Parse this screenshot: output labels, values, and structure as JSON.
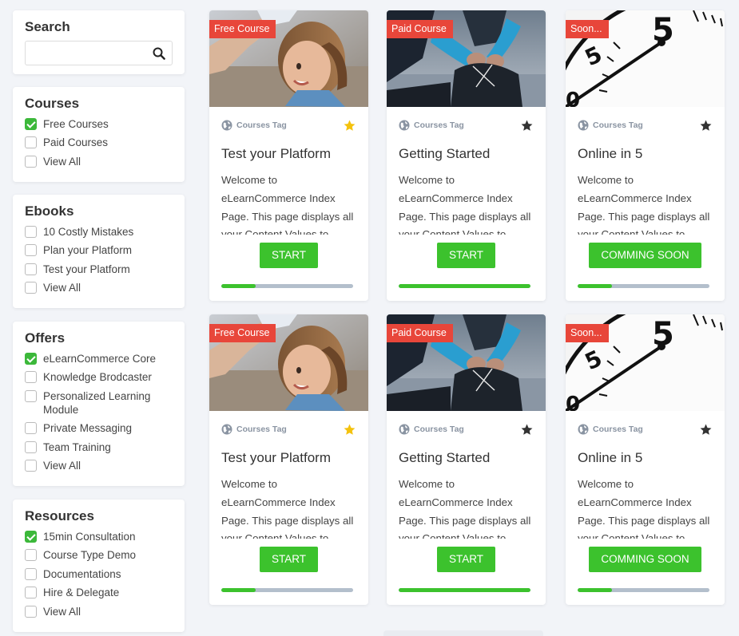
{
  "colors": {
    "accent_green": "#3cc22d",
    "ribbon_red": "#e8463a",
    "star_gold": "#f4c20d",
    "star_dark": "#333333",
    "progress_track": "#b3bfcc"
  },
  "search": {
    "title": "Search",
    "placeholder": "",
    "icon": "search-icon"
  },
  "courses": {
    "title": "Courses",
    "items": [
      {
        "label": "Free Courses",
        "checked": true
      },
      {
        "label": "Paid Courses",
        "checked": false
      },
      {
        "label": "View All",
        "checked": false
      }
    ]
  },
  "ebooks": {
    "title": "Ebooks",
    "items": [
      {
        "label": "10 Costly Mistakes",
        "checked": false
      },
      {
        "label": "Plan your Platform",
        "checked": false
      },
      {
        "label": "Test your Platform",
        "checked": false
      },
      {
        "label": "View All",
        "checked": false
      }
    ]
  },
  "offers": {
    "title": "Offers",
    "items": [
      {
        "label": "eLearnCommerce Core",
        "checked": true
      },
      {
        "label": "Knowledge Brodcaster",
        "checked": false
      },
      {
        "label": "Personalized Learning Module",
        "checked": false
      },
      {
        "label": "Private Messaging",
        "checked": false
      },
      {
        "label": "Team Training",
        "checked": false
      },
      {
        "label": "View All",
        "checked": false
      }
    ]
  },
  "resources": {
    "title": "Resources",
    "items": [
      {
        "label": "15min Consultation",
        "checked": true
      },
      {
        "label": "Course Type Demo",
        "checked": false
      },
      {
        "label": "Documentations",
        "checked": false
      },
      {
        "label": "Hire & Delegate",
        "checked": false
      },
      {
        "label": "View All",
        "checked": false
      }
    ]
  },
  "cards": [
    {
      "ribbon": "Free Course",
      "image": "girl-photo",
      "tag": "Courses Tag",
      "starred": true,
      "title": "Test your Platform",
      "desc": "Welcome to eLearnCommerce Index Page. This page displays all your Content Values to",
      "button": "START",
      "progress": 0.26
    },
    {
      "ribbon": "Paid Course",
      "image": "shoelace-photo",
      "tag": "Courses Tag",
      "starred": false,
      "title": "Getting Started",
      "desc": "Welcome to eLearnCommerce Index Page. This page displays all your Content Values to",
      "button": "START",
      "progress": 1.0
    },
    {
      "ribbon": "Soon...",
      "image": "stopwatch-photo",
      "tag": "Courses Tag",
      "starred": false,
      "title": "Online in 5",
      "desc": "Welcome to eLearnCommerce Index Page. This page displays all your Content Values to",
      "button": "COMMING SOON",
      "progress": 0.26
    },
    {
      "ribbon": "Free Course",
      "image": "girl-photo",
      "tag": "Courses Tag",
      "starred": true,
      "title": "Test your Platform",
      "desc": "Welcome to eLearnCommerce Index Page. This page displays all your Content Values to",
      "button": "START",
      "progress": 0.26
    },
    {
      "ribbon": "Paid Course",
      "image": "shoelace-photo",
      "tag": "Courses Tag",
      "starred": false,
      "title": "Getting Started",
      "desc": "Welcome to eLearnCommerce Index Page. This page displays all your Content Values to",
      "button": "START",
      "progress": 1.0
    },
    {
      "ribbon": "Soon...",
      "image": "stopwatch-photo",
      "tag": "Courses Tag",
      "starred": false,
      "title": "Online in 5",
      "desc": "Welcome to eLearnCommerce Index Page. This page displays all your Content Values to",
      "button": "COMMING SOON",
      "progress": 0.26
    }
  ]
}
